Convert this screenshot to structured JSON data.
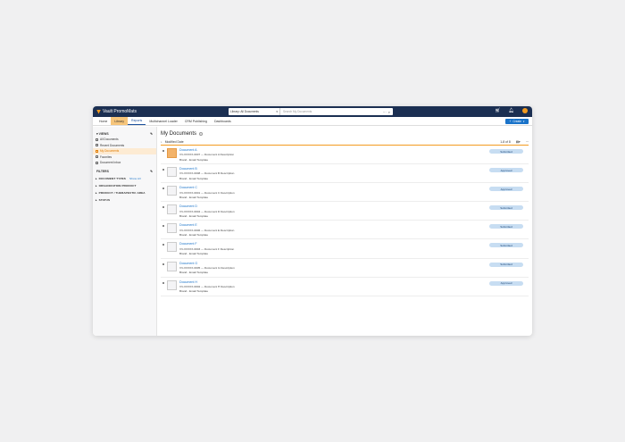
{
  "app": {
    "name": "Vault PromoMats",
    "brand_color": "#1b2f52",
    "accent": "#f39b1f"
  },
  "search": {
    "scope": "Library: All Documents",
    "placeholder": "Search My Documents"
  },
  "nav": {
    "tabs": [
      "Home",
      "Library",
      "Reports",
      "Multichannel Loader",
      "CRM Publishing",
      "Dashboards"
    ],
    "active": "Library",
    "create_label": "Create"
  },
  "sidebar": {
    "views_label": "VIEWS",
    "items": [
      "All Documents",
      "Recent Documents",
      "My Documents",
      "Favorites",
      "Document Inbox"
    ],
    "filters_label": "FILTERS",
    "sections": [
      "DOCUMENT TYPES",
      "ORGANIZATION PRODUCT",
      "PRODUCT / THERAPEUTIC AREA",
      "STATUS"
    ],
    "show_all": "Show All"
  },
  "main": {
    "title": "My Documents",
    "sort_label": "Modified Date",
    "count": "1-8 of 8"
  },
  "documents": [
    {
      "name": "Document A",
      "number": "VV-XXXXX-0007",
      "desc": "Document A Description",
      "meta": "Brand  -  Email Template",
      "status": "Submitted",
      "thumb": "orange"
    },
    {
      "name": "Document B",
      "number": "VV-XXXXX-0008",
      "desc": "Document B Description",
      "meta": "Brand  -  Email Template",
      "status": "Approved",
      "thumb": "plain"
    },
    {
      "name": "Document C",
      "number": "VV-XXXXX-0001",
      "desc": "Document C Description",
      "meta": "Brand  -  Email Template",
      "status": "Approved",
      "thumb": "plain"
    },
    {
      "name": "Document D",
      "number": "VV-XXXXX-0004",
      "desc": "Document D Description",
      "meta": "Brand  -  Email Template",
      "status": "Submitted",
      "thumb": "plain"
    },
    {
      "name": "Document E",
      "number": "VV-XXXXX-0006",
      "desc": "Document E Description",
      "meta": "Brand  -  Email Template",
      "status": "Submitted",
      "thumb": "plain"
    },
    {
      "name": "Document F",
      "number": "VV-XXXXX-0003",
      "desc": "Document F Description",
      "meta": "Brand  -  Email Template",
      "status": "Submitted",
      "thumb": "plain"
    },
    {
      "name": "Document G",
      "number": "VV-XXXXX-0005",
      "desc": "Document G Description",
      "meta": "Brand  -  Email Template",
      "status": "Submitted",
      "thumb": "plain"
    },
    {
      "name": "Document H",
      "number": "VV-XXXXX-0002",
      "desc": "Document H Description",
      "meta": "Brand  -  Email Template",
      "status": "Approved",
      "thumb": "plain"
    }
  ]
}
